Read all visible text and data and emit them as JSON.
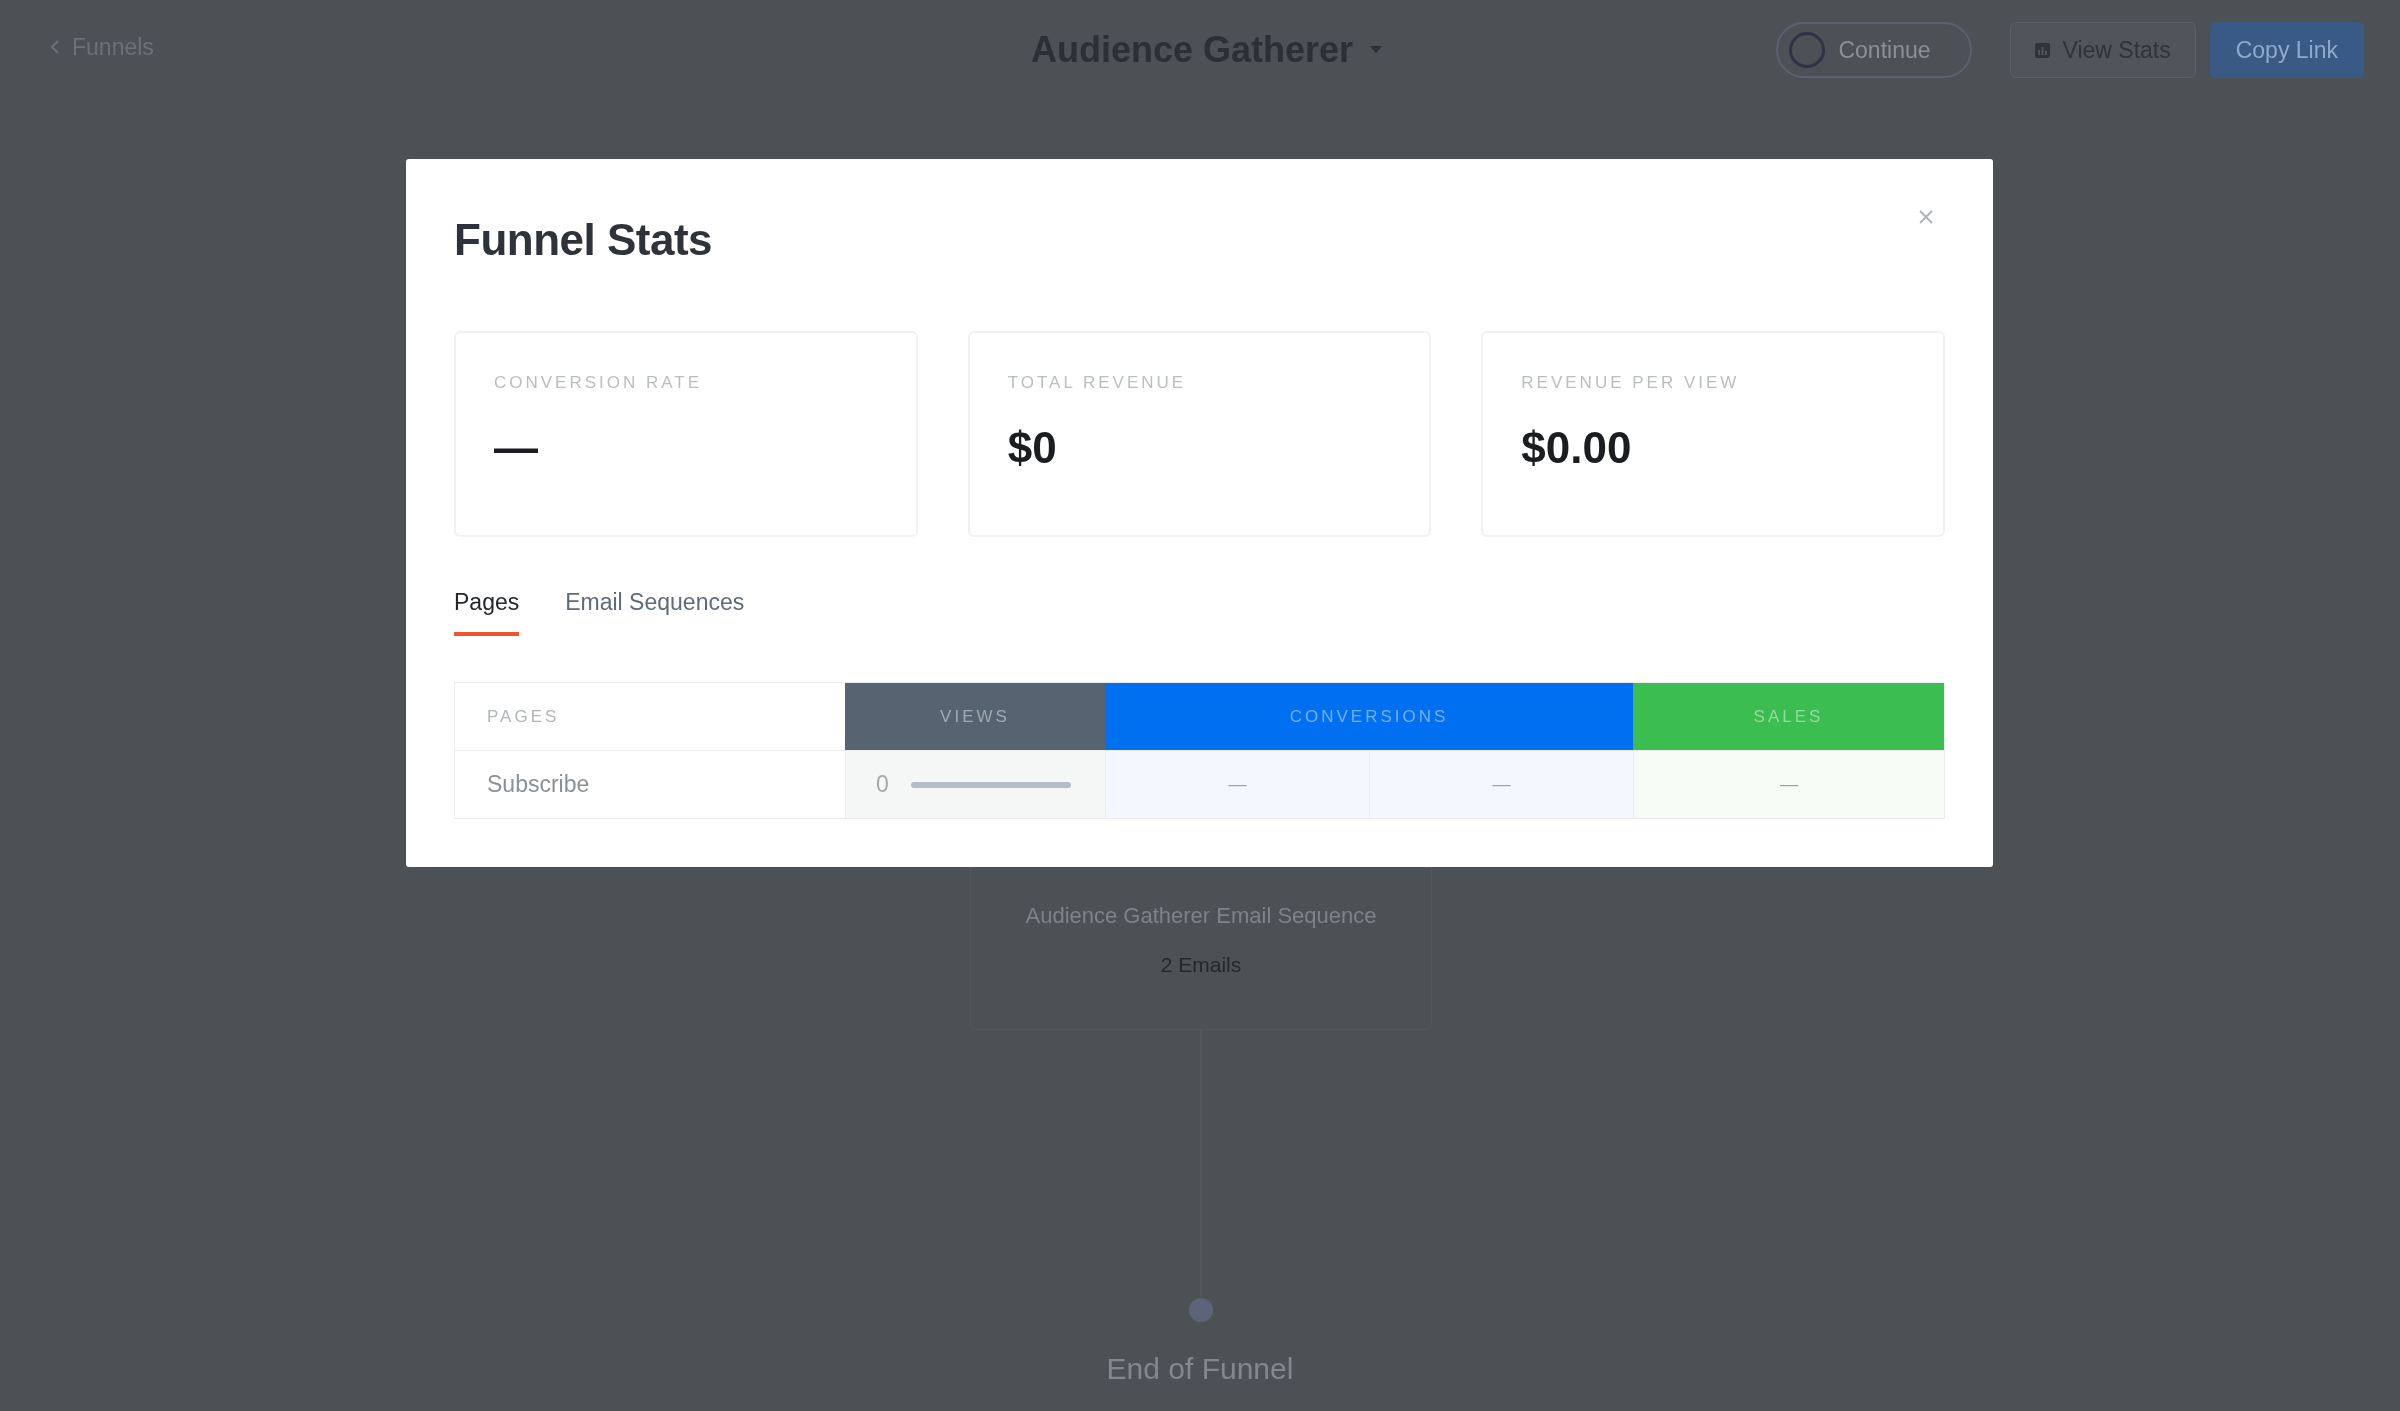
{
  "top_bar": {
    "back_link": "Funnels",
    "funnel_title": "Audience Gatherer",
    "buttons": [
      {
        "label": "Continue",
        "kind": "toggle"
      },
      {
        "label": "View Stats",
        "kind": "stats"
      },
      {
        "label": "Copy Link",
        "kind": "primary"
      }
    ]
  },
  "canvas": {
    "email_step": {
      "name": "Audience Gatherer Email Sequence",
      "count": "2 Emails"
    },
    "end_label": "End of Funnel"
  },
  "modal": {
    "title": "Funnel Stats",
    "stats": [
      {
        "label": "CONVERSION RATE",
        "value": "—"
      },
      {
        "label": "TOTAL REVENUE",
        "value": "$0"
      },
      {
        "label": "REVENUE PER VIEW",
        "value": "$0.00"
      }
    ],
    "tabs": [
      {
        "label": "Pages",
        "selected": true
      },
      {
        "label": "Email Sequences",
        "selected": false
      }
    ],
    "table": {
      "columns": [
        {
          "label": "PAGES",
          "kind": "pages"
        },
        {
          "label": "VIEWS",
          "kind": "views",
          "color": "#566370"
        },
        {
          "label": "CONVERSIONS",
          "kind": "conversions",
          "color": "#0070f0"
        },
        {
          "label": "SALES",
          "kind": "sales",
          "color": "#3bbd4f"
        }
      ],
      "rows": [
        {
          "page": "Subscribe",
          "views": "0",
          "level": 0,
          "conversions": [
            "—",
            "—"
          ],
          "sales": "—"
        }
      ]
    }
  }
}
